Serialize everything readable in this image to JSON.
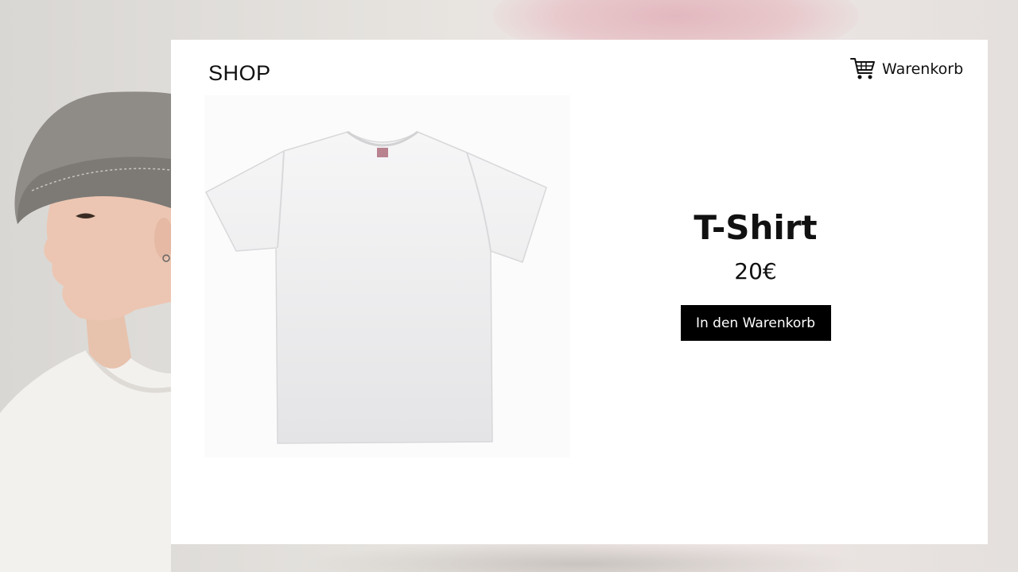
{
  "header": {
    "logo": "SHOP",
    "cart_label": "Warenkorb",
    "cart_icon": "cart-icon"
  },
  "product": {
    "title": "T-Shirt",
    "price": "20€",
    "add_to_cart_label": "In den Warenkorb",
    "image": "white-tshirt-image"
  },
  "colors": {
    "button_bg": "#000000",
    "button_text": "#ffffff",
    "card_bg": "#ffffff"
  }
}
